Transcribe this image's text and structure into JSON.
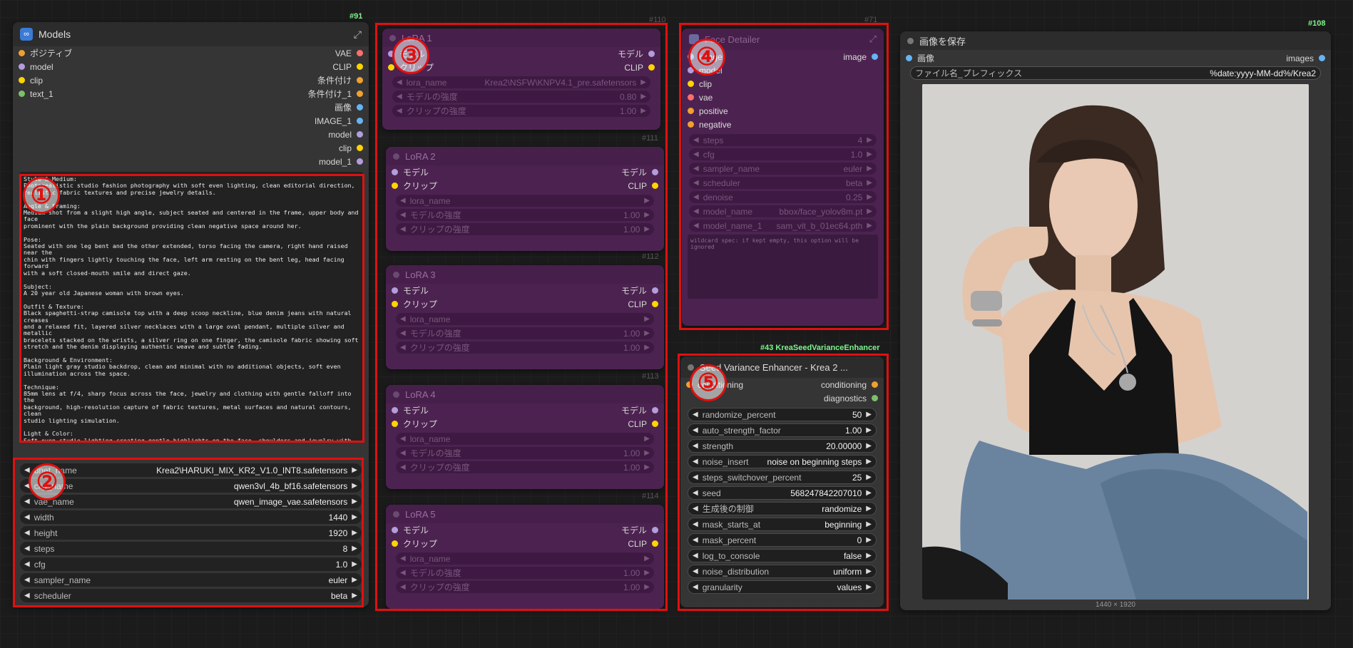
{
  "colors": {
    "accent_green": "#7df58a",
    "highlight_red": "#e01010",
    "lora_bg": "#4c2350",
    "node_bg": "#353535"
  },
  "models_node": {
    "id": "#91",
    "title": "Models",
    "outputs_left": [
      {
        "label": "ポジティブ",
        "color": "#f0a030"
      },
      {
        "label": "model",
        "color": "#b39ddb"
      },
      {
        "label": "clip",
        "color": "#ffd400"
      },
      {
        "label": "text_1",
        "color": "#7cc06a"
      }
    ],
    "outputs_right": [
      {
        "label": "VAE",
        "color": "#ff6e6e"
      },
      {
        "label": "CLIP",
        "color": "#ffd400"
      },
      {
        "label": "条件付け",
        "color": "#f0a030"
      },
      {
        "label": "条件付け_1",
        "color": "#f0a030"
      },
      {
        "label": "画像",
        "color": "#64b5f6"
      },
      {
        "label": "IMAGE_1",
        "color": "#64b5f6"
      },
      {
        "label": "model",
        "color": "#b39ddb"
      },
      {
        "label": "clip",
        "color": "#ffd400"
      },
      {
        "label": "model_1",
        "color": "#b39ddb"
      }
    ],
    "prompt": "Style & Medium:\nPhotorealistic studio fashion photography with soft even lighting, clean editorial direction,\nrealistic fabric textures and precise jewelry details.\n\nAngle & Framing:\nMedium shot from a slight high angle, subject seated and centered in the frame, upper body and face\nprominent with the plain background providing clean negative space around her.\n\nPose:\nSeated with one leg bent and the other extended, torso facing the camera, right hand raised near the\nchin with fingers lightly touching the face, left arm resting on the bent leg, head facing forward\nwith a soft closed-mouth smile and direct gaze.\n\nSubject:\nA 20 year old Japanese woman with brown eyes.\n\nOutfit & Texture:\nBlack spaghetti-strap camisole top with a deep scoop neckline, blue denim jeans with natural creases\nand a relaxed fit, layered silver necklaces with a large oval pendant, multiple silver and metallic\nbracelets stacked on the wrists, a silver ring on one finger, the camisole fabric showing soft\nstretch and the denim displaying authentic weave and subtle fading.\n\nBackground & Environment:\nPlain light gray studio backdrop, clean and minimal with no additional objects, soft even\nillumination across the space.\n\nTechnique:\n85mm lens at f/4, sharp focus across the face, jewelry and clothing with gentle falloff into the\nbackground, high-resolution capture of fabric textures, metal surfaces and natural contours, clean\nstudio lighting simulation.\n\nLight & Color:\nSoft even studio lighting creating gentle highlights on the face, shoulders and jewelry with minimal\nshadows, cool neutral color palette dominated by black, blue denim, silver and soft gray, high\nclarity with smooth tonal gradients.",
    "widgets": [
      {
        "label": "unet_name",
        "value": "Krea2\\HARUKI_MIX_KR2_V1.0_INT8.safetensors"
      },
      {
        "label": "clip_name",
        "value": "qwen3vl_4b_bf16.safetensors"
      },
      {
        "label": "vae_name",
        "value": "qwen_image_vae.safetensors"
      },
      {
        "label": "width",
        "value": "1440"
      },
      {
        "label": "height",
        "value": "1920"
      },
      {
        "label": "steps",
        "value": "8"
      },
      {
        "label": "cfg",
        "value": "1.0"
      },
      {
        "label": "sampler_name",
        "value": "euler"
      },
      {
        "label": "scheduler",
        "value": "beta"
      }
    ]
  },
  "lora_nodes": [
    {
      "id": "#110",
      "title": "LoRA 1",
      "in_model": "モデル",
      "in_clip": "クリップ",
      "out_model": "モデル",
      "out_clip": "CLIP",
      "widgets": [
        {
          "label": "lora_name",
          "value": "Krea2\\NSFW\\KNPV4.1_pre.safetensors"
        },
        {
          "label": "モデルの強度",
          "value": "0.80"
        },
        {
          "label": "クリップの強度",
          "value": "1.00"
        }
      ]
    },
    {
      "id": "#111",
      "title": "LoRA 2",
      "in_model": "モデル",
      "in_clip": "クリップ",
      "out_model": "モデル",
      "out_clip": "CLIP",
      "widgets": [
        {
          "label": "lora_name",
          "value": ""
        },
        {
          "label": "モデルの強度",
          "value": "1.00"
        },
        {
          "label": "クリップの強度",
          "value": "1.00"
        }
      ]
    },
    {
      "id": "#112",
      "title": "LoRA 3",
      "in_model": "モデル",
      "in_clip": "クリップ",
      "out_model": "モデル",
      "out_clip": "CLIP",
      "widgets": [
        {
          "label": "lora_name",
          "value": ""
        },
        {
          "label": "モデルの強度",
          "value": "1.00"
        },
        {
          "label": "クリップの強度",
          "value": "1.00"
        }
      ]
    },
    {
      "id": "#113",
      "title": "LoRA 4",
      "in_model": "モデル",
      "in_clip": "クリップ",
      "out_model": "モデル",
      "out_clip": "CLIP",
      "widgets": [
        {
          "label": "lora_name",
          "value": ""
        },
        {
          "label": "モデルの強度",
          "value": "1.00"
        },
        {
          "label": "クリップの強度",
          "value": "1.00"
        }
      ]
    },
    {
      "id": "#114",
      "title": "LoRA 5",
      "in_model": "モデル",
      "in_clip": "クリップ",
      "out_model": "モデル",
      "out_clip": "CLIP",
      "widgets": [
        {
          "label": "lora_name",
          "value": ""
        },
        {
          "label": "モデルの強度",
          "value": "1.00"
        },
        {
          "label": "クリップの強度",
          "value": "1.00"
        }
      ]
    }
  ],
  "detailer_node": {
    "id": "#71",
    "title": "Face Detailer",
    "inputs": [
      {
        "label": "image",
        "color": "#64b5f6"
      },
      {
        "label": "model",
        "color": "#b39ddb"
      },
      {
        "label": "clip",
        "color": "#ffd400"
      },
      {
        "label": "vae",
        "color": "#ff6e6e"
      },
      {
        "label": "positive",
        "color": "#f0a030"
      },
      {
        "label": "negative",
        "color": "#f0a030"
      }
    ],
    "output": "image",
    "widgets": [
      {
        "label": "steps",
        "value": "4"
      },
      {
        "label": "cfg",
        "value": "1.0"
      },
      {
        "label": "sampler_name",
        "value": "euler"
      },
      {
        "label": "scheduler",
        "value": "beta"
      },
      {
        "label": "denoise",
        "value": "0.25"
      },
      {
        "label": "model_name",
        "value": "bbox/face_yolov8m.pt"
      },
      {
        "label": "model_name_1",
        "value": "sam_vit_b_01ec64.pth"
      }
    ],
    "wildcard_placeholder": "wildcard spec: if kept empty, this option will be ignored"
  },
  "seed_node": {
    "id": "#43 KreaSeedVarianceEnhancer",
    "title": "Seed Variance Enhancer - Krea 2 ...",
    "input": "conditioning",
    "outputs": [
      "conditioning",
      "diagnostics"
    ],
    "widgets": [
      {
        "label": "randomize_percent",
        "value": "50"
      },
      {
        "label": "auto_strength_factor",
        "value": "1.00"
      },
      {
        "label": "strength",
        "value": "20.00000"
      },
      {
        "label": "noise_insert",
        "value": "noise on beginning steps"
      },
      {
        "label": "steps_switchover_percent",
        "value": "25"
      },
      {
        "label": "seed",
        "value": "568247842207010"
      },
      {
        "label": "生成後の制御",
        "value": "randomize"
      },
      {
        "label": "mask_starts_at",
        "value": "beginning"
      },
      {
        "label": "mask_percent",
        "value": "0"
      },
      {
        "label": "log_to_console",
        "value": "false"
      },
      {
        "label": "noise_distribution",
        "value": "uniform"
      },
      {
        "label": "granularity",
        "value": "values"
      }
    ]
  },
  "save_node": {
    "id": "#108",
    "title": "画像を保存",
    "input": "画像",
    "output": "images",
    "prefix_label": "ファイル名_プレフィックス",
    "prefix_value": "%date:yyyy-MM-dd%/Krea2",
    "image_size": "1440 × 1920"
  },
  "badges": [
    "①",
    "②",
    "③",
    "④",
    "⑤"
  ]
}
